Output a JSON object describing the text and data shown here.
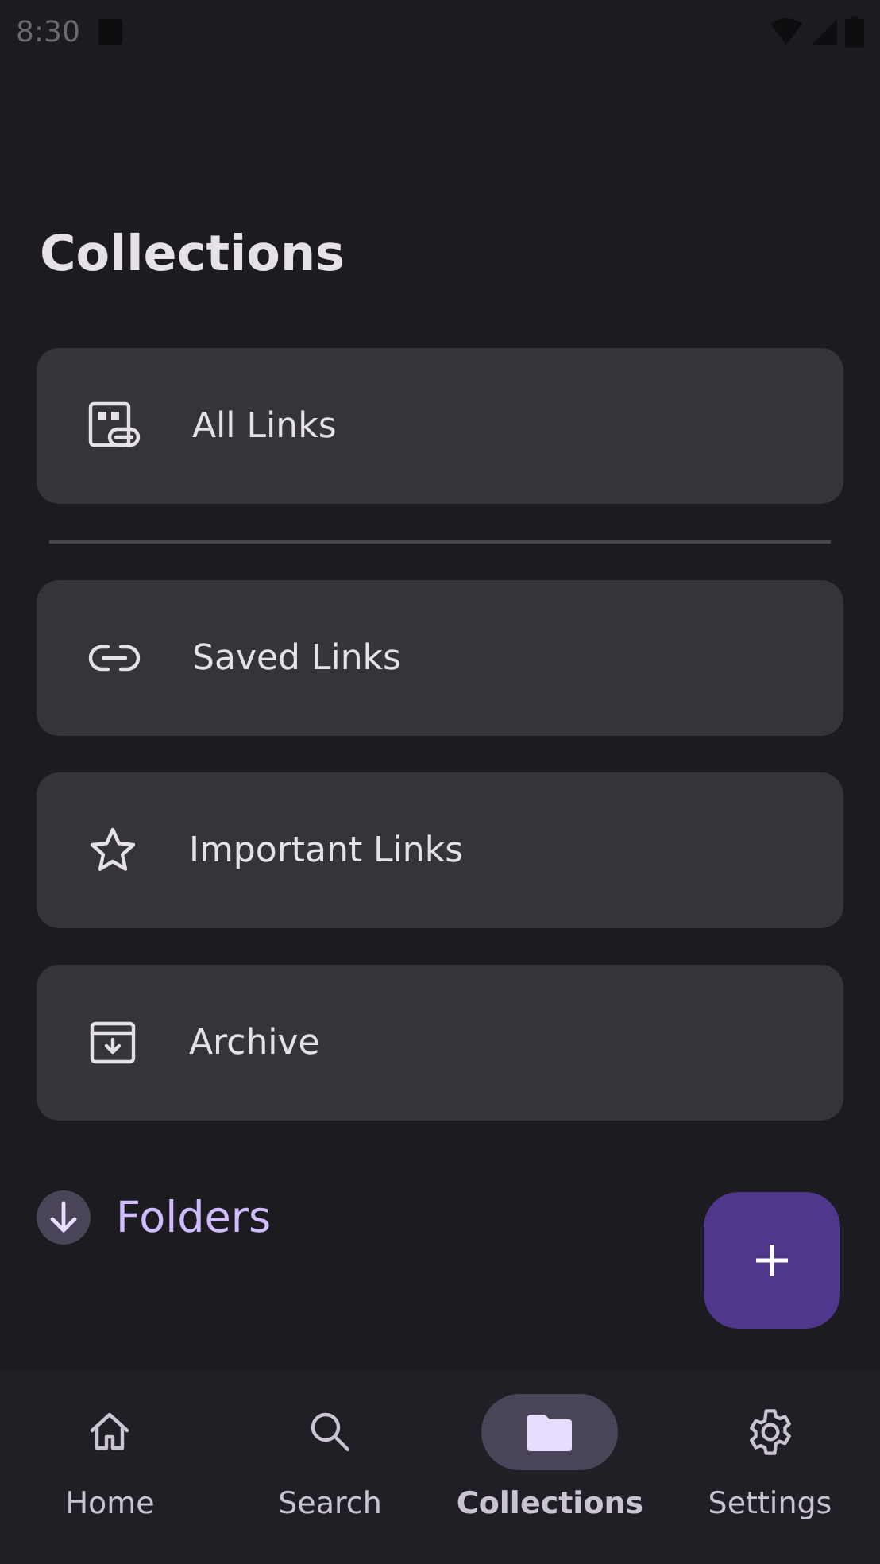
{
  "status_bar": {
    "time": "8:30"
  },
  "title": "Collections",
  "primary_items": [
    {
      "label": "All Links"
    }
  ],
  "items": [
    {
      "label": "Saved Links"
    },
    {
      "label": "Important Links"
    },
    {
      "label": "Archive"
    }
  ],
  "folders": {
    "label": "Folders",
    "expanded": false
  },
  "nav": [
    {
      "label": "Home",
      "selected": false
    },
    {
      "label": "Search",
      "selected": false
    },
    {
      "label": "Collections",
      "selected": true
    },
    {
      "label": "Settings",
      "selected": false
    }
  ]
}
